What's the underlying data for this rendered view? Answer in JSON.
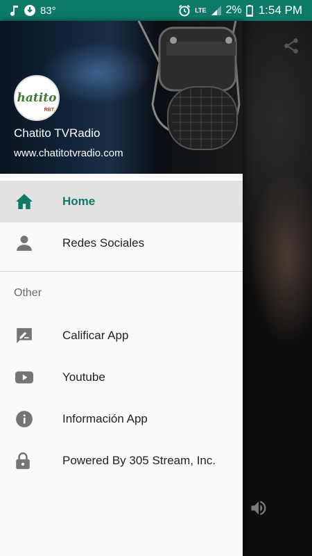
{
  "status_bar": {
    "temperature": "83°",
    "network": "LTE",
    "battery_percent": "2%",
    "time": "1:54 PM"
  },
  "drawer": {
    "header": {
      "logo_text": "hatito",
      "logo_sub": "RBT",
      "title": "Chatito TVRadio",
      "subtitle": "www.chatitotvradio.com"
    },
    "primary_items": [
      {
        "label": "Home",
        "icon": "home-icon",
        "active": true
      },
      {
        "label": "Redes Sociales",
        "icon": "person-icon",
        "active": false
      }
    ],
    "other_section": {
      "header": "Other",
      "items": [
        {
          "label": "Calificar App",
          "icon": "rate-review-icon"
        },
        {
          "label": "Youtube",
          "icon": "youtube-icon"
        },
        {
          "label": "Información App",
          "icon": "info-icon"
        },
        {
          "label": "Powered By 305 Stream, Inc.",
          "icon": "lock-icon"
        }
      ]
    }
  },
  "colors": {
    "accent": "#0d7a68",
    "status_bar": "#0d7a68",
    "active_item_bg": "#e2e2e2",
    "icon_gray": "#757575"
  }
}
